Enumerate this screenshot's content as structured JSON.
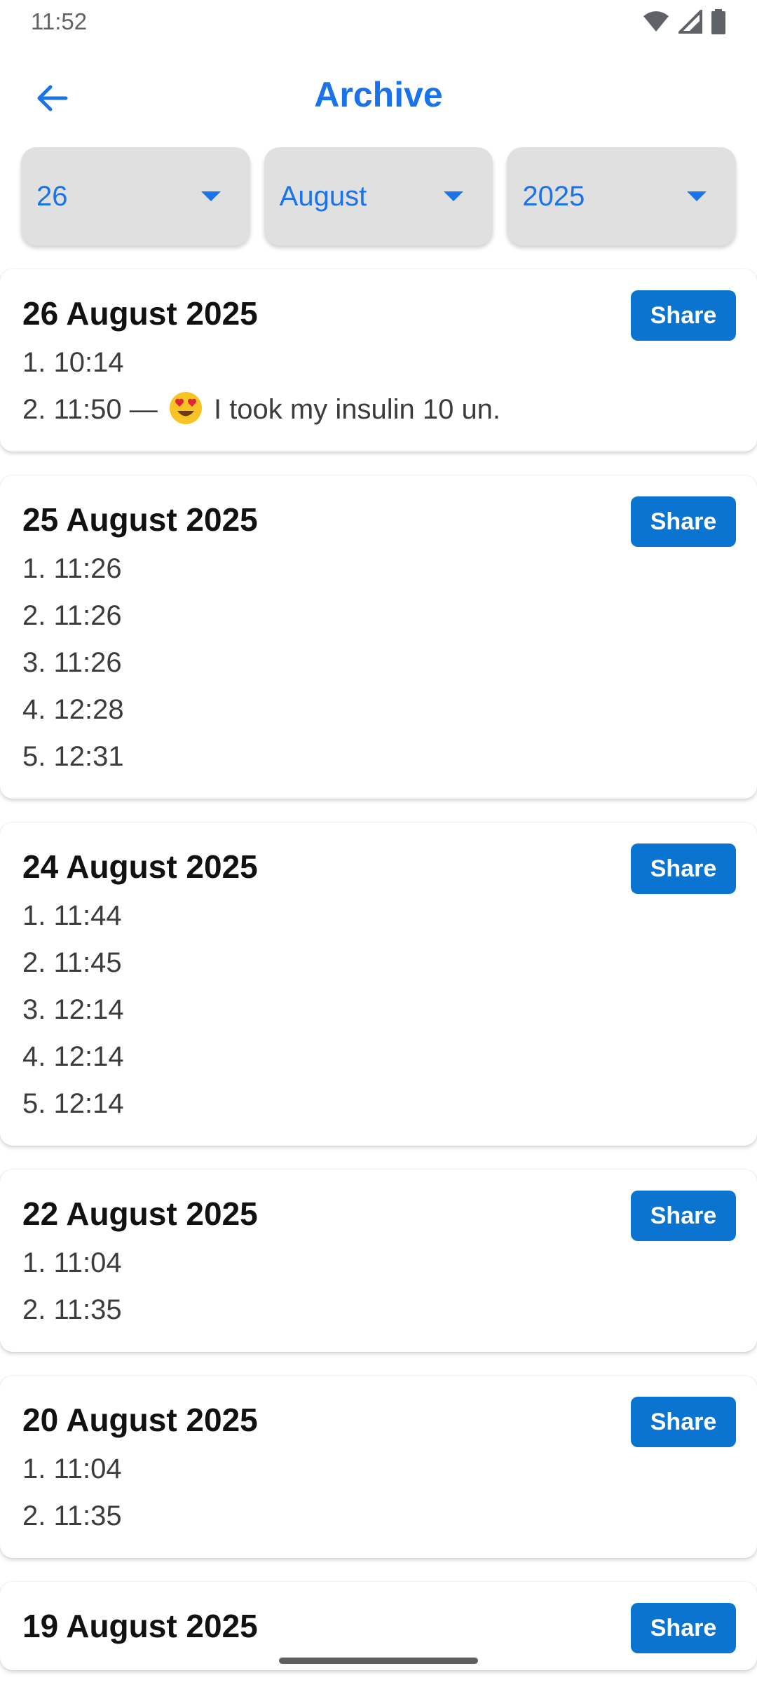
{
  "status_bar": {
    "time": "11:52",
    "icons": [
      "wifi-icon",
      "signal-icon",
      "battery-icon"
    ]
  },
  "app_bar": {
    "title": "Archive",
    "back_icon": "arrow-left-icon"
  },
  "filters": {
    "day": "26",
    "month": "August",
    "year": "2025"
  },
  "colors": {
    "accent": "#1a73e8",
    "share_button": "#0a74d0",
    "filter_bg": "#e0e0e0"
  },
  "share_label": "Share",
  "days": [
    {
      "date": "26 August 2025",
      "entries": [
        {
          "text": "1. 10:14"
        },
        {
          "text_before": "2. 11:50 — ",
          "emoji": "heart-eyes-emoji",
          "text_after": " I took my insulin 10 un."
        }
      ]
    },
    {
      "date": "25 August 2025",
      "entries": [
        {
          "text": "1. 11:26"
        },
        {
          "text": "2. 11:26"
        },
        {
          "text": "3. 11:26"
        },
        {
          "text": "4. 12:28"
        },
        {
          "text": "5. 12:31"
        }
      ]
    },
    {
      "date": "24 August 2025",
      "entries": [
        {
          "text": "1. 11:44"
        },
        {
          "text": "2. 11:45"
        },
        {
          "text": "3. 12:14"
        },
        {
          "text": "4. 12:14"
        },
        {
          "text": "5. 12:14"
        }
      ]
    },
    {
      "date": "22 August 2025",
      "entries": [
        {
          "text": "1. 11:04"
        },
        {
          "text": "2. 11:35"
        }
      ]
    },
    {
      "date": "20 August 2025",
      "entries": [
        {
          "text": "1. 11:04"
        },
        {
          "text": "2. 11:35"
        }
      ]
    },
    {
      "date": "19 August 2025",
      "entries": []
    }
  ]
}
